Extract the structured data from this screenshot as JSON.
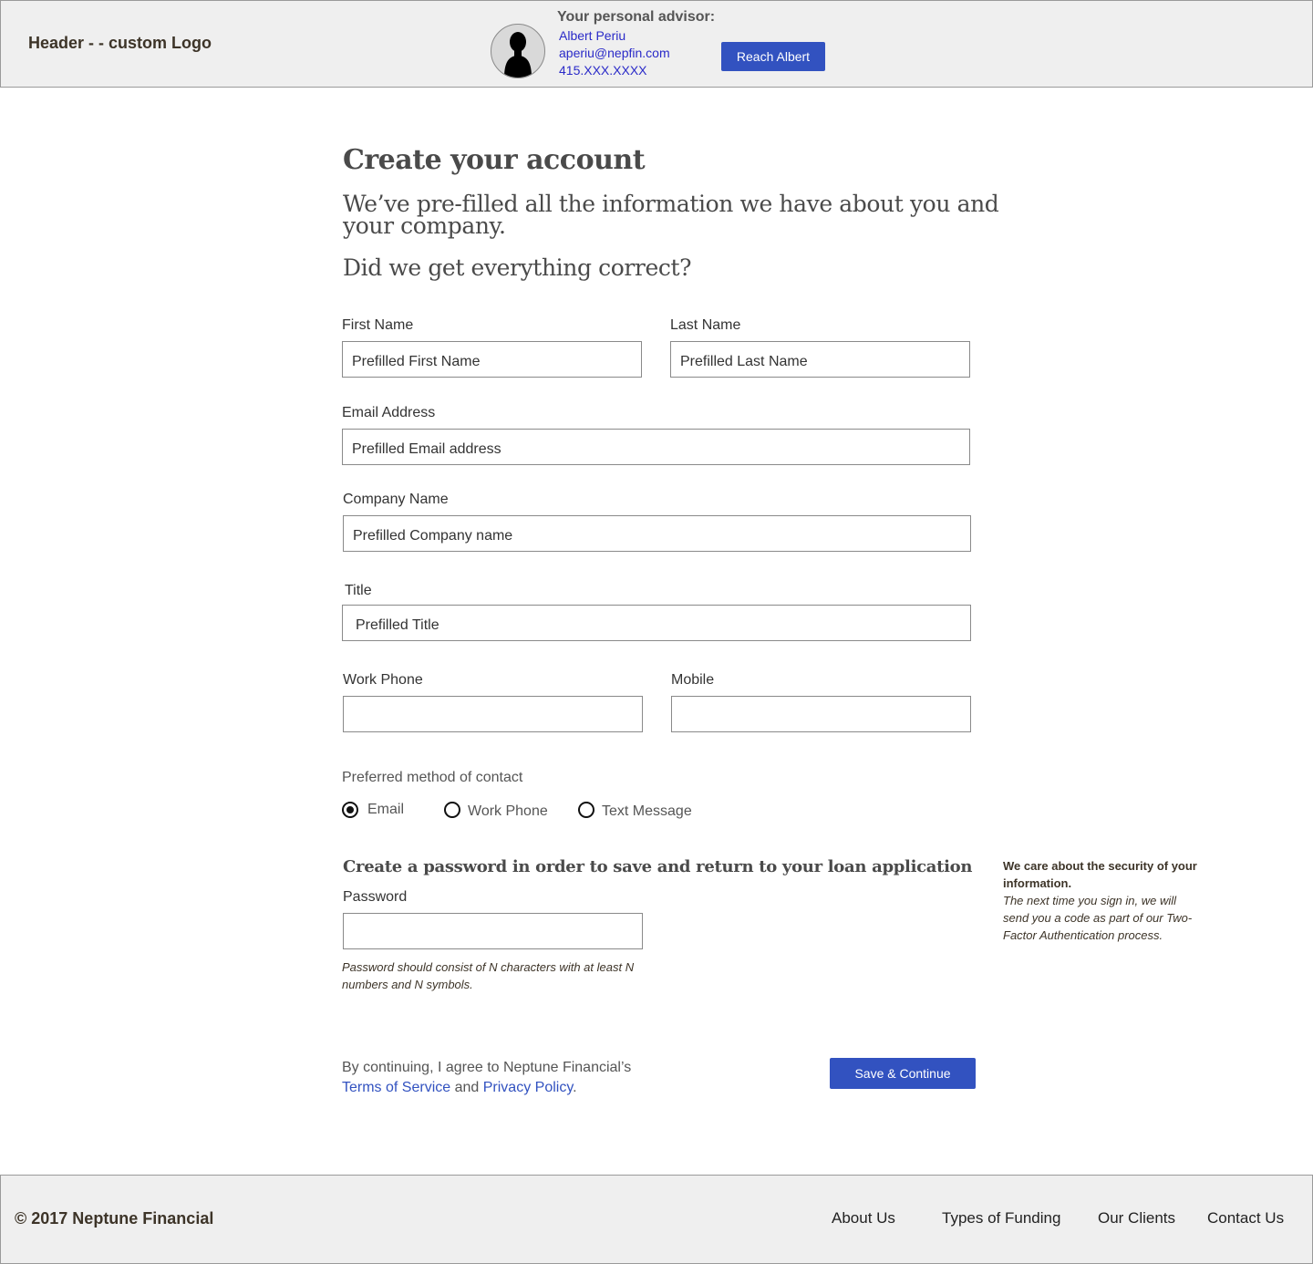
{
  "header": {
    "logo": "Header - - custom Logo",
    "advisor_title": "Your personal advisor:",
    "advisor_name": "Albert Periu",
    "advisor_email": "aperiu@nepfin.com",
    "advisor_phone": "415.XXX.XXXX",
    "reach_button": "Reach Albert",
    "avatar_icon": "person-silhouette-icon"
  },
  "main": {
    "title": "Create your account",
    "intro": "We’ve pre-filled all the information we have about you and your company.",
    "question": "Did we get everything correct?",
    "fields": {
      "first_name": {
        "label": "First Name",
        "value": "Prefilled First Name"
      },
      "last_name": {
        "label": "Last Name",
        "value": "Prefilled Last Name"
      },
      "email": {
        "label": "Email Address",
        "value": "Prefilled Email address"
      },
      "company": {
        "label": "Company Name",
        "value": "Prefilled Company name"
      },
      "title": {
        "label": "Title",
        "value": "Prefilled Title"
      },
      "work_phone": {
        "label": "Work Phone",
        "value": ""
      },
      "mobile": {
        "label": "Mobile",
        "value": ""
      },
      "password": {
        "label": "Password",
        "value": ""
      }
    },
    "contact_method": {
      "label": "Preferred method of contact",
      "options": [
        "Email",
        "Work Phone",
        "Text Message"
      ],
      "selected": "Email"
    },
    "password_heading": "Create a password in order to save and return to your loan application",
    "password_hint": "Password should consist of N characters with at least N numbers and N symbols.",
    "security_title": "We care about the security of your information.",
    "security_body": "The next time you sign in, we will send you a code as part of our Two-Factor Authentication process.",
    "agreement_prefix": "By continuing, I agree to Neptune Financial’s",
    "terms_link": "Terms of Service",
    "agreement_and": "and",
    "privacy_link": "Privacy Policy",
    "agreement_end": ".",
    "save_button": "Save & Continue"
  },
  "footer": {
    "copyright": "© 2017 Neptune Financial",
    "links": [
      "About Us",
      "Types of Funding",
      "Our Clients",
      "Contact Us"
    ]
  },
  "colors": {
    "accent": "#3252c0",
    "header_bg": "#efefef",
    "link": "#2a2ac8"
  }
}
